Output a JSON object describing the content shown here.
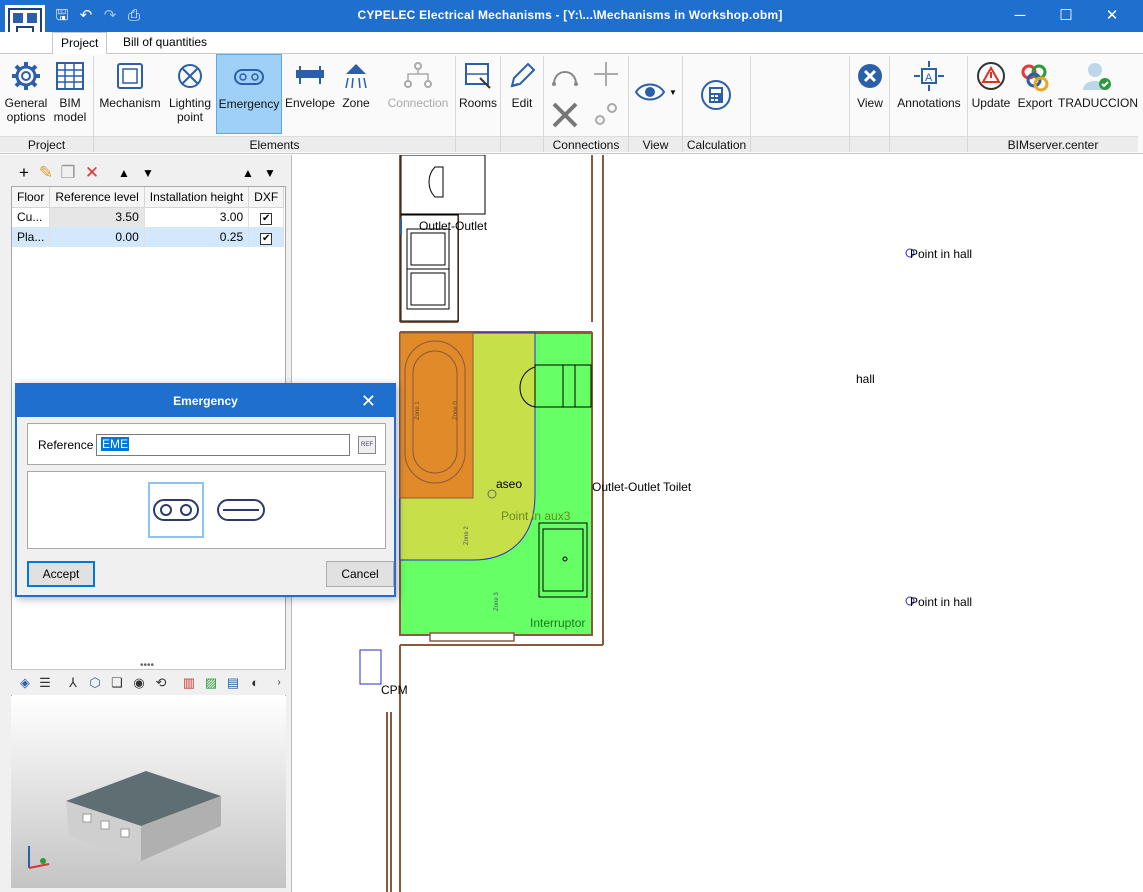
{
  "window": {
    "title": "CYPELEC Electrical Mechanisms - [Y:\\...\\Mechanisms in Workshop.obm]",
    "controls": [
      "minimize",
      "maximize",
      "close"
    ]
  },
  "tabs": [
    "Project",
    "Bill of quantities"
  ],
  "ribbon": {
    "project": {
      "label": "Project",
      "general_options": [
        "General",
        "options"
      ],
      "bim_model": [
        "BIM",
        "model"
      ]
    },
    "elements": {
      "label": "Elements",
      "mechanism": "Mechanism",
      "lighting_point": [
        "Lighting",
        "point"
      ],
      "emergency": "Emergency",
      "envelope": "Envelope",
      "zone": "Zone",
      "connection": "Connection"
    },
    "rooms": "Rooms",
    "edit": "Edit",
    "connections_label": "Connections",
    "view_group_label": "View",
    "calculation_label": "Calculation",
    "view": "View",
    "annotations": "Annotations",
    "bimserver": {
      "label": "BIMserver.center",
      "update": "Update",
      "export": "Export",
      "traduccion": "TRADUCCION"
    }
  },
  "floors_table": {
    "headers": [
      "Floor",
      "Reference level",
      "Installation height",
      "DXF"
    ],
    "rows": [
      {
        "floor": "Cu...",
        "ref_level": "3.50",
        "inst_height": "3.00",
        "dxf": "✔"
      },
      {
        "floor": "Pla...",
        "ref_level": "0.00",
        "inst_height": "0.25",
        "dxf": "✔"
      }
    ]
  },
  "canvas_labels": {
    "outlet_outlet": "Outlet-Outlet",
    "point_in_hall_1": "Point in hall",
    "hall": "hall",
    "aseo": "aseo",
    "outlet_toilet": "Outlet-Outlet Toilet",
    "point_in_aux3": "Point in aux3",
    "interruptor": "Interruptor",
    "point_in_hall_2": "Point in hall",
    "cpm": "CPM",
    "zone1_a": "Zone 1",
    "zone1_b": "Zone 0",
    "zone2": "Zone 2",
    "zone3": "Zone 3"
  },
  "dialog": {
    "title": "Emergency",
    "reference_label": "Reference",
    "reference_value": "EME",
    "ref_button": "REF",
    "accept": "Accept",
    "cancel": "Cancel"
  },
  "colors": {
    "titlebar": "#1f6fce",
    "zone_orange": "#e08a2a",
    "zone_lime": "#c7e04a",
    "zone_green": "#66ff66",
    "wall": "#8b5a3c"
  }
}
